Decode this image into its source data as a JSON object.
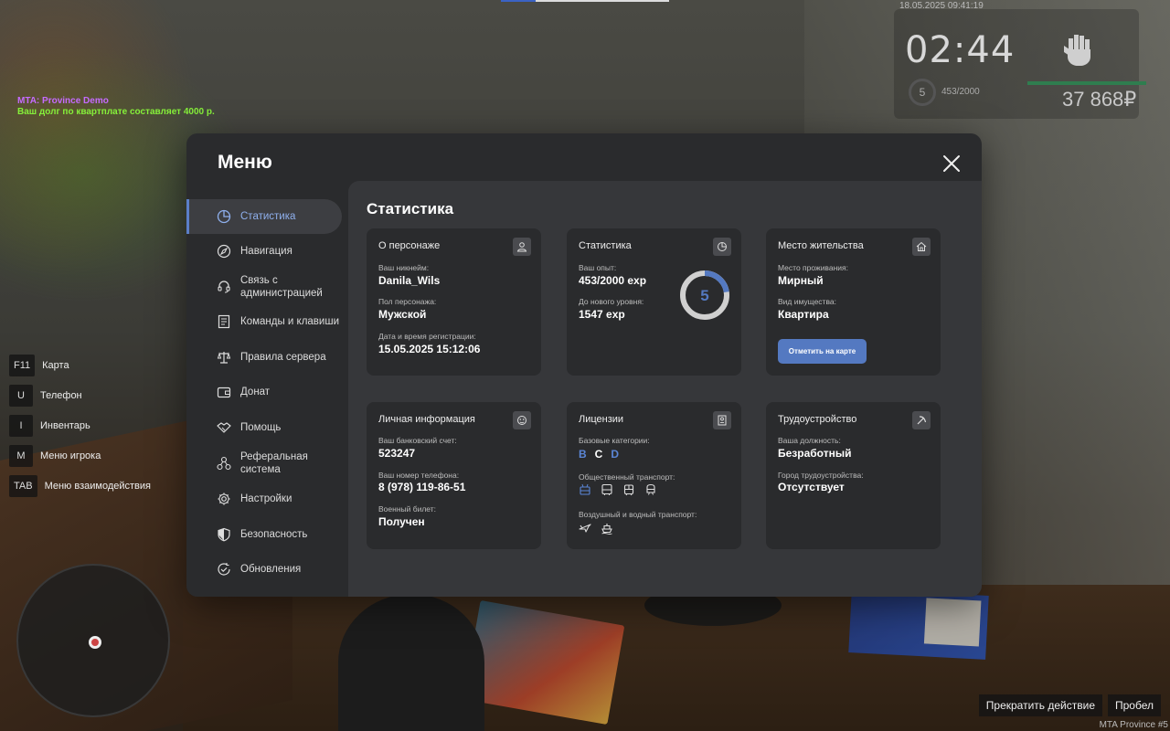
{
  "chat": {
    "line1": "MTA: Province Demo",
    "line2": "Ваш долг по квартплате составляет 4000 р."
  },
  "hud": {
    "datetime": "18.05.2025 09:41:19",
    "clock": "02:44",
    "level": "5",
    "xp": "453/2000",
    "money": "37 868₽",
    "health_fraction": 1.0
  },
  "keybinds": [
    {
      "key": "F11",
      "label": "Карта"
    },
    {
      "key": "U",
      "label": "Телефон"
    },
    {
      "key": "I",
      "label": "Инвентарь"
    },
    {
      "key": "M",
      "label": "Меню игрока"
    },
    {
      "key": "TAB",
      "label": "Меню взаимодействия"
    }
  ],
  "bottom": {
    "stop_action": "Прекратить действие",
    "space": "Пробел",
    "server": "MTA Province #5"
  },
  "menu": {
    "title": "Меню",
    "sidebar": [
      {
        "label": "Статистика",
        "icon": "pie-chart-icon",
        "active": true
      },
      {
        "label": "Навигация",
        "icon": "compass-icon"
      },
      {
        "label": "Связь с администрацией",
        "label_l1": "Связь с",
        "label_l2": "администрацией",
        "icon": "headset-icon"
      },
      {
        "label": "Команды и клавиши",
        "icon": "document-icon"
      },
      {
        "label": "Правила сервера",
        "icon": "scales-icon"
      },
      {
        "label": "Донат",
        "icon": "wallet-icon"
      },
      {
        "label": "Помощь",
        "icon": "handshake-icon"
      },
      {
        "label": "Реферальная система",
        "label_l1": "Реферальная",
        "label_l2": "система",
        "icon": "referral-icon"
      },
      {
        "label": "Настройки",
        "icon": "gear-icon"
      },
      {
        "label": "Безопасность",
        "icon": "shield-icon"
      },
      {
        "label": "Обновления",
        "icon": "refresh-check-icon"
      }
    ],
    "content_title": "Статистика",
    "cards": {
      "character": {
        "title": "О персонаже",
        "icon": "user-icon",
        "nick_label": "Ваш никнейм:",
        "nick": "Danila_Wils",
        "gender_label": "Пол персонажа:",
        "gender": "Мужской",
        "reg_label": "Дата и время регистрации:",
        "reg": "15.05.2025 15:12:06"
      },
      "stats": {
        "title": "Статистика",
        "icon": "stats-icon",
        "exp_label": "Ваш опыт:",
        "exp": "453/2000 exp",
        "next_label": "До нового уровня:",
        "next": "1547 exp",
        "level": "5",
        "progress": 0.2265
      },
      "residence": {
        "title": "Место жительства",
        "icon": "house-icon",
        "place_label": "Место проживания:",
        "place": "Мирный",
        "type_label": "Вид имущества:",
        "type": "Квартира",
        "button": "Отметить на карте"
      },
      "personal": {
        "title": "Личная информация",
        "icon": "badge-icon",
        "bank_label": "Ваш банковский счет:",
        "bank": "523247",
        "phone_label": "Ваш номер телефона:",
        "phone": "8 (978) 119-86-51",
        "military_label": "Военный билет:",
        "military": "Получен"
      },
      "licenses": {
        "title": "Лицензии",
        "icon": "license-icon",
        "base_label": "Базовые категории:",
        "categories": [
          "B",
          "C",
          "D"
        ],
        "public_label": "Общественный транспорт:",
        "public_icons": [
          "trolleybus-icon",
          "bus-icon",
          "tram-icon",
          "metro-icon"
        ],
        "airwater_label": "Воздушный и водный транспорт:",
        "airwater_icons": [
          "plane-icon",
          "ship-icon"
        ]
      },
      "employment": {
        "title": "Трудоустройство",
        "icon": "pickaxe-icon",
        "job_label": "Ваша должность:",
        "job": "Безработный",
        "city_label": "Город трудоустройства:",
        "city": "Отсутствует"
      }
    }
  },
  "colors": {
    "accent": "#5479c1",
    "active_text": "#8fb0ee",
    "panel": "#2a2b2d",
    "content": "#36373a"
  }
}
